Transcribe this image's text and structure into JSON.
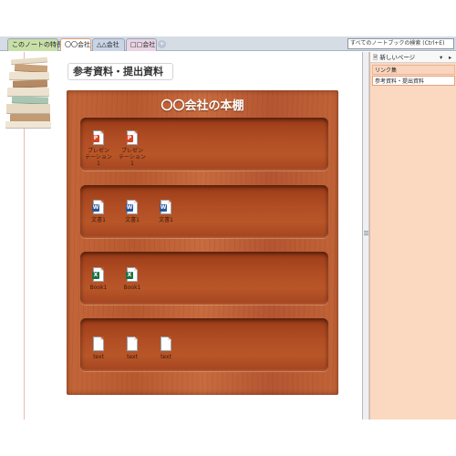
{
  "tabs": [
    {
      "label": "このノートの特長"
    },
    {
      "label": "〇〇会社"
    },
    {
      "label": "△△会社"
    },
    {
      "label": "□□会社"
    }
  ],
  "search": {
    "placeholder": "すべてのノートブックの検索 (Ctrl+E)"
  },
  "page": {
    "title": "参考資料・提出資料"
  },
  "shelf": {
    "title": "〇〇会社の本棚",
    "rows": [
      {
        "files": [
          {
            "label": "プレゼン\nテーション1",
            "type": "powerpoint",
            "badge": "P",
            "color": "#d24726"
          },
          {
            "label": "プレゼン\nテーション1",
            "type": "powerpoint",
            "badge": "P",
            "color": "#d24726"
          }
        ]
      },
      {
        "files": [
          {
            "label": "文書1",
            "type": "word",
            "badge": "W",
            "color": "#2b5797"
          },
          {
            "label": "文書1",
            "type": "word",
            "badge": "W",
            "color": "#2b5797"
          },
          {
            "label": "文書1",
            "type": "word",
            "badge": "W",
            "color": "#2b5797"
          }
        ]
      },
      {
        "files": [
          {
            "label": "Book1",
            "type": "excel",
            "badge": "X",
            "color": "#1e7145"
          },
          {
            "label": "Book1",
            "type": "excel",
            "badge": "X",
            "color": "#1e7145"
          }
        ]
      },
      {
        "files": [
          {
            "label": "text",
            "type": "text",
            "badge": "",
            "color": "#9ca4ac"
          },
          {
            "label": "text",
            "type": "text",
            "badge": "",
            "color": "#9ca4ac"
          },
          {
            "label": "text",
            "type": "text",
            "badge": "",
            "color": "#9ca4ac"
          }
        ]
      }
    ]
  },
  "right_panel": {
    "new_page_label": "新しいページ",
    "pages": [
      {
        "label": "リンク集"
      },
      {
        "label": "参考資料・提出資料"
      }
    ]
  },
  "icons": {
    "add_tab": "plus-icon",
    "new_page": "new-page-icon",
    "dropdown": "chevron-down-icon",
    "collapse": "chevron-right-icon"
  }
}
